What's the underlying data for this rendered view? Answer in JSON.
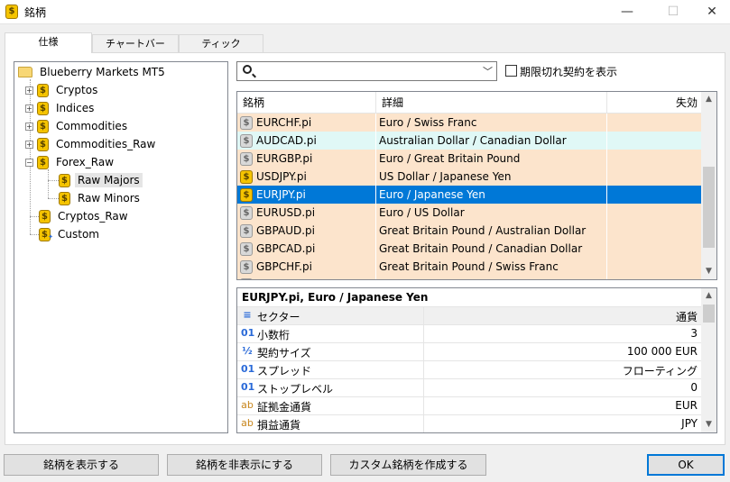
{
  "window": {
    "title": "銘柄",
    "minimize": "—",
    "maximize": "☐",
    "close": "✕"
  },
  "tabs": [
    {
      "label": "仕様",
      "active": true
    },
    {
      "label": "チャートバー",
      "active": false
    },
    {
      "label": "ティック",
      "active": false
    }
  ],
  "tree": {
    "root": "Blueberry Markets MT5",
    "nodes": [
      {
        "label": "Cryptos",
        "expander": "+"
      },
      {
        "label": "Indices",
        "expander": "+"
      },
      {
        "label": "Commodities",
        "expander": "+"
      },
      {
        "label": "Commodities_Raw",
        "expander": "+"
      },
      {
        "label": "Forex_Raw",
        "expander": "−"
      },
      {
        "label": "Raw Majors",
        "selected": true
      },
      {
        "label": "Raw Minors"
      },
      {
        "label": "Cryptos_Raw"
      },
      {
        "label": "Custom"
      }
    ]
  },
  "search": {
    "value": "",
    "placeholder": ""
  },
  "show_expired": {
    "label": "期限切れ契約を表示",
    "checked": false
  },
  "symbols_table": {
    "columns": [
      "銘柄",
      "詳細",
      "失効"
    ],
    "rows": [
      {
        "symbol": "EURCHF.pi",
        "description": "Euro / Swiss Franc",
        "expiry": "",
        "icon": "gray",
        "bg": "#fce4cc"
      },
      {
        "symbol": "AUDCAD.pi",
        "description": "Australian Dollar / Canadian Dollar",
        "expiry": "",
        "icon": "gray",
        "bg": "#e0f8f6"
      },
      {
        "symbol": "EURGBP.pi",
        "description": "Euro / Great Britain Pound",
        "expiry": "",
        "icon": "gray",
        "bg": "#fce4cc"
      },
      {
        "symbol": "USDJPY.pi",
        "description": "US Dollar / Japanese Yen",
        "expiry": "",
        "icon": "gold",
        "bg": "#fce4cc"
      },
      {
        "symbol": "EURJPY.pi",
        "description": "Euro / Japanese Yen",
        "expiry": "",
        "icon": "gold",
        "bg": "#0078d7",
        "selected": true
      },
      {
        "symbol": "EURUSD.pi",
        "description": "Euro / US Dollar",
        "expiry": "",
        "icon": "gray",
        "bg": "#fce4cc"
      },
      {
        "symbol": "GBPAUD.pi",
        "description": "Great Britain Pound / Australian Dollar",
        "expiry": "",
        "icon": "gray",
        "bg": "#fce4cc"
      },
      {
        "symbol": "GBPCAD.pi",
        "description": "Great Britain Pound / Canadian Dollar",
        "expiry": "",
        "icon": "gray",
        "bg": "#fce4cc"
      },
      {
        "symbol": "GBPCHF.pi",
        "description": "Great Britain Pound / Swiss Franc",
        "expiry": "",
        "icon": "gray",
        "bg": "#fce4cc"
      },
      {
        "symbol": "",
        "description": "",
        "expiry": "",
        "icon": "gray",
        "bg": "#fce4cc"
      }
    ]
  },
  "properties": {
    "title": "EURJPY.pi, Euro / Japanese Yen",
    "rows": [
      {
        "icon": "≡",
        "icon_name": "sector-icon",
        "name": "セクター",
        "value": "通貨",
        "header": true
      },
      {
        "icon": "01",
        "icon_name": "integer-icon",
        "name": "小数桁",
        "value": "3"
      },
      {
        "icon": "½",
        "icon_name": "fraction-icon",
        "name": "契約サイズ",
        "value": "100 000 EUR"
      },
      {
        "icon": "01",
        "icon_name": "integer-icon",
        "name": "スプレッド",
        "value": "フローティング"
      },
      {
        "icon": "01",
        "icon_name": "integer-icon",
        "name": "ストップレベル",
        "value": "0"
      },
      {
        "icon": "ab",
        "icon_name": "text-icon",
        "name": "証拠金通貨",
        "value": "EUR",
        "orange": true
      },
      {
        "icon": "ab",
        "icon_name": "text-icon",
        "name": "損益通貨",
        "value": "JPY",
        "orange": true
      }
    ]
  },
  "buttons": {
    "show": "銘柄を表示する",
    "hide": "銘柄を非表示にする",
    "custom": "カスタム銘柄を作成する",
    "ok": "OK"
  },
  "colors": {
    "selection": "#0078d7",
    "row_peach": "#fce4cc",
    "row_cyan": "#e0f8f6"
  }
}
